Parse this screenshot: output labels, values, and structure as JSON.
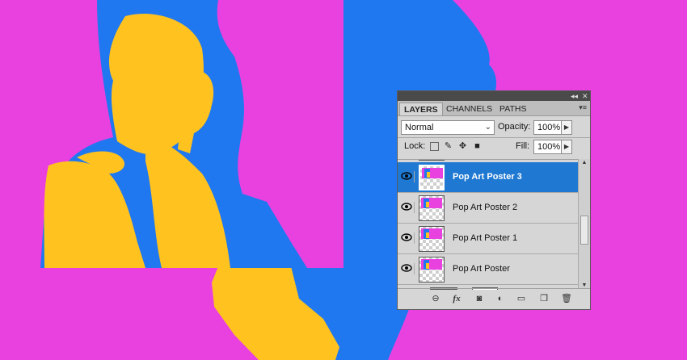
{
  "panel": {
    "tabs": [
      {
        "label": "LAYERS",
        "active": true
      },
      {
        "label": "CHANNELS",
        "active": false
      },
      {
        "label": "PATHS",
        "active": false
      }
    ],
    "menu_glyph": "▾≡",
    "collapse_glyph": "◂◂",
    "close_glyph": "✕",
    "blend_mode": "Normal",
    "opacity_label": "Opacity:",
    "opacity_value": "100%",
    "lock_label": "Lock:",
    "fill_label": "Fill:",
    "fill_value": "100%",
    "layers": [
      {
        "name": "Pop Art Poster 3",
        "selected": true,
        "visible": true
      },
      {
        "name": "Pop Art Poster 2",
        "selected": false,
        "visible": true
      },
      {
        "name": "Pop Art Poster 1",
        "selected": false,
        "visible": true
      },
      {
        "name": "Pop Art Poster",
        "selected": false,
        "visible": true
      }
    ],
    "footer_icons": [
      "link-icon",
      "fx-icon",
      "mask-icon",
      "adjustment-icon",
      "group-folder-icon",
      "new-layer-icon",
      "trash-icon"
    ]
  },
  "canvas": {
    "colors": {
      "magenta": "#e940e0",
      "blue": "#1f78f0",
      "yellow": "#ffc21f"
    }
  }
}
